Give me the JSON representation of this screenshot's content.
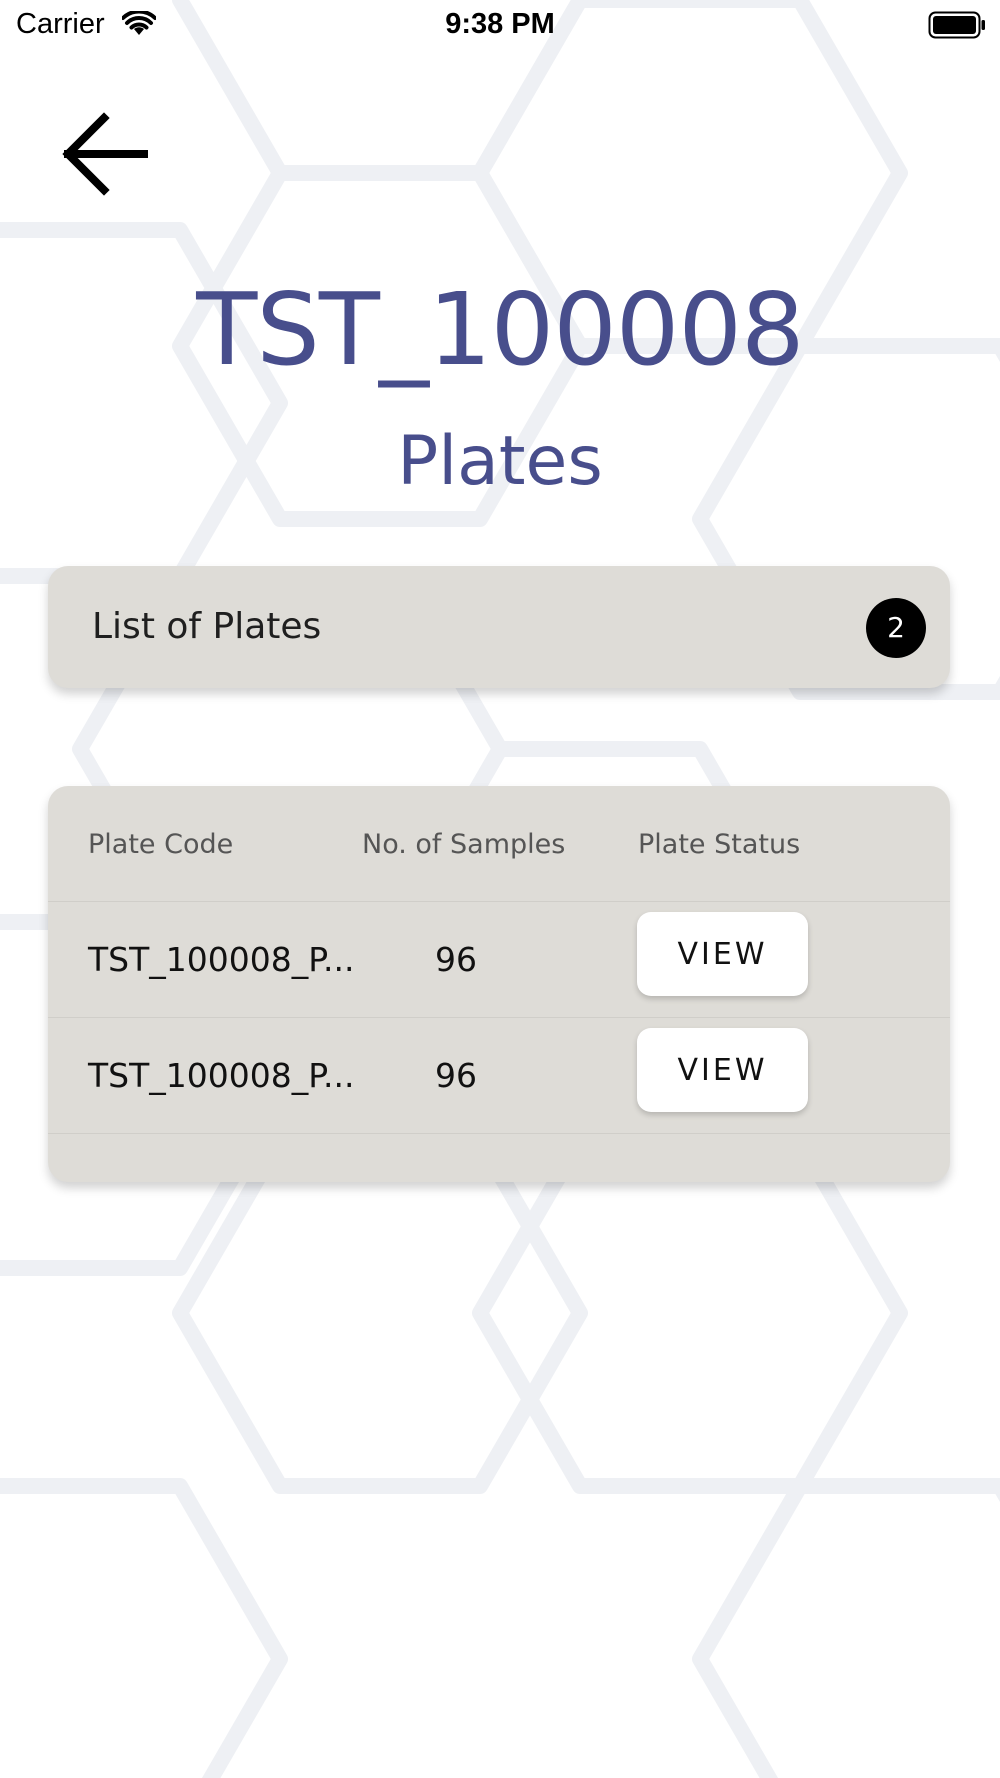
{
  "status_bar": {
    "carrier": "Carrier",
    "time": "9:38 PM",
    "wifi_icon": "wifi-icon",
    "battery_icon": "battery-icon"
  },
  "nav": {
    "back_icon": "arrow-left-icon"
  },
  "header": {
    "title": "TST_100008",
    "subtitle": "Plates"
  },
  "list_header": {
    "label": "List of Plates",
    "count": "2"
  },
  "table": {
    "columns": [
      "Plate Code",
      "No. of Samples",
      "Plate Status"
    ],
    "rows": [
      {
        "code": "TST_100008_P...",
        "samples": "96",
        "action": "VIEW"
      },
      {
        "code": "TST_100008_P...",
        "samples": "96",
        "action": "VIEW"
      }
    ]
  },
  "colors": {
    "title": "#484e8c",
    "card": "#dedcd7",
    "badge": "#000000",
    "button": "#ffffff"
  }
}
